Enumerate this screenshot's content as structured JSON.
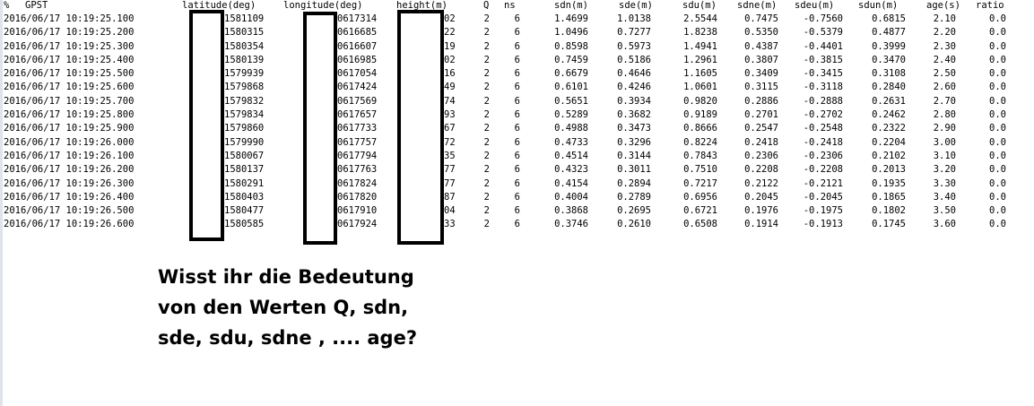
{
  "header": {
    "pct": "%",
    "gpst": "GPST",
    "latitude": "latitude(deg)",
    "longitude": "longitude(deg)",
    "height": "height(m)",
    "q": "Q",
    "ns": "ns",
    "sdn": "sdn(m)",
    "sde": "sde(m)",
    "sdu": "sdu(m)",
    "sdne": "sdne(m)",
    "sdeu": "sdeu(m)",
    "sdun": "sdun(m)",
    "age": "age(s)",
    "ratio": "ratio"
  },
  "rows": [
    {
      "gpst": "2016/06/17 10:19:25.100",
      "lat": "1581109",
      "lon": "0617314",
      "h": "02",
      "q": "2",
      "ns": "6",
      "sdn": "1.4699",
      "sde": "1.0138",
      "sdu": "2.5544",
      "sdne": "0.7475",
      "sdeu": "-0.7560",
      "sdun": "0.6815",
      "age": "2.10",
      "ratio": "0.0"
    },
    {
      "gpst": "2016/06/17 10:19:25.200",
      "lat": "1580315",
      "lon": "0616685",
      "h": "22",
      "q": "2",
      "ns": "6",
      "sdn": "1.0496",
      "sde": "0.7277",
      "sdu": "1.8238",
      "sdne": "0.5350",
      "sdeu": "-0.5379",
      "sdun": "0.4877",
      "age": "2.20",
      "ratio": "0.0"
    },
    {
      "gpst": "2016/06/17 10:19:25.300",
      "lat": "1580354",
      "lon": "0616607",
      "h": "19",
      "q": "2",
      "ns": "6",
      "sdn": "0.8598",
      "sde": "0.5973",
      "sdu": "1.4941",
      "sdne": "0.4387",
      "sdeu": "-0.4401",
      "sdun": "0.3999",
      "age": "2.30",
      "ratio": "0.0"
    },
    {
      "gpst": "2016/06/17 10:19:25.400",
      "lat": "1580139",
      "lon": "0616985",
      "h": "02",
      "q": "2",
      "ns": "6",
      "sdn": "0.7459",
      "sde": "0.5186",
      "sdu": "1.2961",
      "sdne": "0.3807",
      "sdeu": "-0.3815",
      "sdun": "0.3470",
      "age": "2.40",
      "ratio": "0.0"
    },
    {
      "gpst": "2016/06/17 10:19:25.500",
      "lat": "1579939",
      "lon": "0617054",
      "h": "16",
      "q": "2",
      "ns": "6",
      "sdn": "0.6679",
      "sde": "0.4646",
      "sdu": "1.1605",
      "sdne": "0.3409",
      "sdeu": "-0.3415",
      "sdun": "0.3108",
      "age": "2.50",
      "ratio": "0.0"
    },
    {
      "gpst": "2016/06/17 10:19:25.600",
      "lat": "1579868",
      "lon": "0617424",
      "h": "49",
      "q": "2",
      "ns": "6",
      "sdn": "0.6101",
      "sde": "0.4246",
      "sdu": "1.0601",
      "sdne": "0.3115",
      "sdeu": "-0.3118",
      "sdun": "0.2840",
      "age": "2.60",
      "ratio": "0.0"
    },
    {
      "gpst": "2016/06/17 10:19:25.700",
      "lat": "1579832",
      "lon": "0617569",
      "h": "74",
      "q": "2",
      "ns": "6",
      "sdn": "0.5651",
      "sde": "0.3934",
      "sdu": "0.9820",
      "sdne": "0.2886",
      "sdeu": "-0.2888",
      "sdun": "0.2631",
      "age": "2.70",
      "ratio": "0.0"
    },
    {
      "gpst": "2016/06/17 10:19:25.800",
      "lat": "1579834",
      "lon": "0617657",
      "h": "93",
      "q": "2",
      "ns": "6",
      "sdn": "0.5289",
      "sde": "0.3682",
      "sdu": "0.9189",
      "sdne": "0.2701",
      "sdeu": "-0.2702",
      "sdun": "0.2462",
      "age": "2.80",
      "ratio": "0.0"
    },
    {
      "gpst": "2016/06/17 10:19:25.900",
      "lat": "1579860",
      "lon": "0617733",
      "h": "67",
      "q": "2",
      "ns": "6",
      "sdn": "0.4988",
      "sde": "0.3473",
      "sdu": "0.8666",
      "sdne": "0.2547",
      "sdeu": "-0.2548",
      "sdun": "0.2322",
      "age": "2.90",
      "ratio": "0.0"
    },
    {
      "gpst": "2016/06/17 10:19:26.000",
      "lat": "1579990",
      "lon": "0617757",
      "h": "72",
      "q": "2",
      "ns": "6",
      "sdn": "0.4733",
      "sde": "0.3296",
      "sdu": "0.8224",
      "sdne": "0.2418",
      "sdeu": "-0.2418",
      "sdun": "0.2204",
      "age": "3.00",
      "ratio": "0.0"
    },
    {
      "gpst": "2016/06/17 10:19:26.100",
      "lat": "1580067",
      "lon": "0617794",
      "h": "35",
      "q": "2",
      "ns": "6",
      "sdn": "0.4514",
      "sde": "0.3144",
      "sdu": "0.7843",
      "sdne": "0.2306",
      "sdeu": "-0.2306",
      "sdun": "0.2102",
      "age": "3.10",
      "ratio": "0.0"
    },
    {
      "gpst": "2016/06/17 10:19:26.200",
      "lat": "1580137",
      "lon": "0617763",
      "h": "77",
      "q": "2",
      "ns": "6",
      "sdn": "0.4323",
      "sde": "0.3011",
      "sdu": "0.7510",
      "sdne": "0.2208",
      "sdeu": "-0.2208",
      "sdun": "0.2013",
      "age": "3.20",
      "ratio": "0.0"
    },
    {
      "gpst": "2016/06/17 10:19:26.300",
      "lat": "1580291",
      "lon": "0617824",
      "h": "77",
      "q": "2",
      "ns": "6",
      "sdn": "0.4154",
      "sde": "0.2894",
      "sdu": "0.7217",
      "sdne": "0.2122",
      "sdeu": "-0.2121",
      "sdun": "0.1935",
      "age": "3.30",
      "ratio": "0.0"
    },
    {
      "gpst": "2016/06/17 10:19:26.400",
      "lat": "1580403",
      "lon": "0617820",
      "h": "87",
      "q": "2",
      "ns": "6",
      "sdn": "0.4004",
      "sde": "0.2789",
      "sdu": "0.6956",
      "sdne": "0.2045",
      "sdeu": "-0.2045",
      "sdun": "0.1865",
      "age": "3.40",
      "ratio": "0.0"
    },
    {
      "gpst": "2016/06/17 10:19:26.500",
      "lat": "1580477",
      "lon": "0617910",
      "h": "04",
      "q": "2",
      "ns": "6",
      "sdn": "0.3868",
      "sde": "0.2695",
      "sdu": "0.6721",
      "sdne": "0.1976",
      "sdeu": "-0.1975",
      "sdun": "0.1802",
      "age": "3.50",
      "ratio": "0.0"
    },
    {
      "gpst": "2016/06/17 10:19:26.600",
      "lat": "1580585",
      "lon": "0617924",
      "h": "33",
      "q": "2",
      "ns": "6",
      "sdn": "0.3746",
      "sde": "0.2610",
      "sdu": "0.6508",
      "sdne": "0.1914",
      "sdeu": "-0.1913",
      "sdun": "0.1745",
      "age": "3.60",
      "ratio": "0.0"
    }
  ],
  "question": {
    "line1": "Wisst ihr die Bedeutung",
    "line2": "von den Werten Q, sdn,",
    "line3": "sde, sdu, sdne , .... age?"
  }
}
